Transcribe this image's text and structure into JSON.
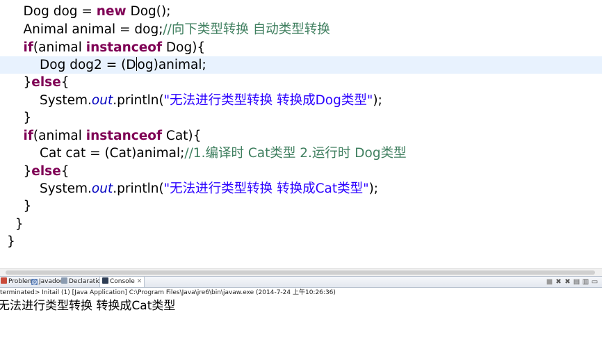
{
  "editor": {
    "lines": [
      [
        {
          "t": "plain",
          "v": "    Dog dog = "
        },
        {
          "t": "kw",
          "v": "new"
        },
        {
          "t": "plain",
          "v": " Dog();"
        }
      ],
      [
        {
          "t": "plain",
          "v": "    Animal animal = dog;"
        },
        {
          "t": "cm",
          "v": "//向下类型转换 自动类型转换"
        }
      ],
      [
        {
          "t": "plain",
          "v": "    "
        },
        {
          "t": "kw",
          "v": "if"
        },
        {
          "t": "plain",
          "v": "(animal "
        },
        {
          "t": "kw",
          "v": "instanceof"
        },
        {
          "t": "plain",
          "v": " Dog){"
        }
      ],
      [
        {
          "t": "plain",
          "v": "        Dog dog2 = (D"
        },
        {
          "t": "caret",
          "v": ""
        },
        {
          "t": "plain",
          "v": "og)animal;"
        }
      ],
      [
        {
          "t": "plain",
          "v": "    }"
        },
        {
          "t": "kw",
          "v": "else"
        },
        {
          "t": "plain",
          "v": "{"
        }
      ],
      [
        {
          "t": "plain",
          "v": "        System."
        },
        {
          "t": "field",
          "v": "out"
        },
        {
          "t": "plain",
          "v": ".println("
        },
        {
          "t": "str",
          "v": "\"无法进行类型转换 转换成Dog类型\""
        },
        {
          "t": "plain",
          "v": ");"
        }
      ],
      [
        {
          "t": "plain",
          "v": "    }"
        }
      ],
      [
        {
          "t": "plain",
          "v": "    "
        },
        {
          "t": "kw",
          "v": "if"
        },
        {
          "t": "plain",
          "v": "(animal "
        },
        {
          "t": "kw",
          "v": "instanceof"
        },
        {
          "t": "plain",
          "v": " Cat){"
        }
      ],
      [
        {
          "t": "plain",
          "v": "        Cat cat = (Cat)animal;"
        },
        {
          "t": "cm",
          "v": "//1.编译时 Cat类型 2.运行时 Dog类型"
        }
      ],
      [
        {
          "t": "plain",
          "v": "    }"
        },
        {
          "t": "kw",
          "v": "else"
        },
        {
          "t": "plain",
          "v": "{"
        }
      ],
      [
        {
          "t": "plain",
          "v": "        System."
        },
        {
          "t": "field",
          "v": "out"
        },
        {
          "t": "plain",
          "v": ".println("
        },
        {
          "t": "str",
          "v": "\"无法进行类型转换 转换成Cat类型\""
        },
        {
          "t": "plain",
          "v": ");"
        }
      ],
      [
        {
          "t": "plain",
          "v": "    }"
        }
      ],
      [
        {
          "t": "plain",
          "v": "  }"
        }
      ],
      [
        {
          "t": "plain",
          "v": "}"
        }
      ]
    ]
  },
  "panel": {
    "tabs": [
      {
        "label": "Problems",
        "icon": "problems-icon"
      },
      {
        "label": "Javadoc",
        "icon": "javadoc-icon"
      },
      {
        "label": "Declaration",
        "icon": "declaration-icon"
      },
      {
        "label": "Console",
        "icon": "console-icon",
        "active": true
      }
    ],
    "console_header": "terminated> Initail (1) [Java Application] C:\\Program Files\\Java\\jre6\\bin\\javaw.exe (2014-7-24 上午10:26:36)",
    "output_lines": [
      "无法进行类型转换 转换成Cat类型"
    ]
  },
  "colors": {
    "keyword": "#7f0055",
    "comment": "#3f7f5f",
    "string": "#2a00ff",
    "field": "#0000c0",
    "current_line": "#e8f2fe"
  }
}
